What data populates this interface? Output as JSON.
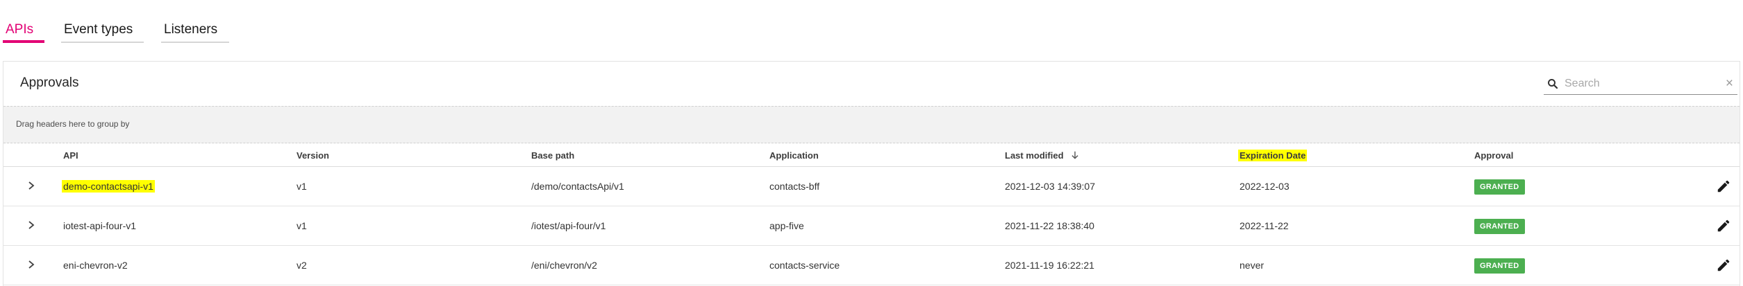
{
  "tabs": [
    {
      "label": "APIs",
      "active": true
    },
    {
      "label": "Event types",
      "active": false
    },
    {
      "label": "Listeners",
      "active": false
    }
  ],
  "panel": {
    "title": "Approvals",
    "search": {
      "placeholder": "Search",
      "value": "",
      "clear_symbol": "×"
    },
    "group_hint": "Drag headers here to group by"
  },
  "grid": {
    "columns": {
      "api": "API",
      "version": "Version",
      "base_path": "Base path",
      "application": "Application",
      "last_modified": "Last modified",
      "expiration_date": "Expiration Date",
      "approval": "Approval"
    },
    "sort_icon": "arrow-down-icon",
    "rows": [
      {
        "api": "demo-contactsapi-v1",
        "version": "v1",
        "base_path": "/demo/contactsApi/v1",
        "application": "contacts-bff",
        "last_modified": "2021-12-03 14:39:07",
        "expiration_date": "2022-12-03",
        "approval": "GRANTED"
      },
      {
        "api": "iotest-api-four-v1",
        "version": "v1",
        "base_path": "/iotest/api-four/v1",
        "application": "app-five",
        "last_modified": "2021-11-22 18:38:40",
        "expiration_date": "2022-11-22",
        "approval": "GRANTED"
      },
      {
        "api": "eni-chevron-v2",
        "version": "v2",
        "base_path": "/eni/chevron/v2",
        "application": "contacts-service",
        "last_modified": "2021-11-19 16:22:21",
        "expiration_date": "never",
        "approval": "GRANTED"
      }
    ]
  },
  "colors": {
    "accent": "#e20074",
    "granted": "#4caf50",
    "highlight": "#ffff00"
  }
}
